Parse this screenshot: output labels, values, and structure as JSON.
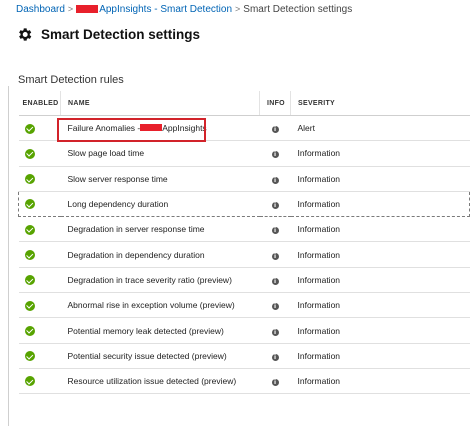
{
  "breadcrumb": {
    "root": "Dashboard",
    "middle": "AppInsights - Smart Detection",
    "current": "Smart Detection settings",
    "separator": ">"
  },
  "page": {
    "title": "Smart Detection settings",
    "title_icon": "gear-icon"
  },
  "section": {
    "title": "Smart Detection rules"
  },
  "table": {
    "columns": [
      "ENABLED",
      "NAME",
      "INFO",
      "SEVERITY"
    ],
    "rows": [
      {
        "enabled": true,
        "name_prefix": "Failure Anomalies -",
        "name_suffix": "AppInsights",
        "severity": "Alert"
      },
      {
        "enabled": true,
        "name": "Slow page load time",
        "severity": "Information"
      },
      {
        "enabled": true,
        "name": "Slow server response time",
        "severity": "Information"
      },
      {
        "enabled": true,
        "name": "Long dependency duration",
        "severity": "Information",
        "focused": true
      },
      {
        "enabled": true,
        "name": "Degradation in server response time",
        "severity": "Information"
      },
      {
        "enabled": true,
        "name": "Degradation in dependency duration",
        "severity": "Information"
      },
      {
        "enabled": true,
        "name": "Degradation in trace severity ratio (preview)",
        "severity": "Information"
      },
      {
        "enabled": true,
        "name": "Abnormal rise in exception volume (preview)",
        "severity": "Information"
      },
      {
        "enabled": true,
        "name": "Potential memory leak detected (preview)",
        "severity": "Information"
      },
      {
        "enabled": true,
        "name": "Potential security issue detected (preview)",
        "severity": "Information"
      },
      {
        "enabled": true,
        "name": "Resource utilization issue detected (preview)",
        "severity": "Information"
      }
    ]
  },
  "colors": {
    "link": "#0064b5",
    "enabled": "#57a300",
    "highlight": "#d2232a",
    "redaction": "#e8202b"
  }
}
